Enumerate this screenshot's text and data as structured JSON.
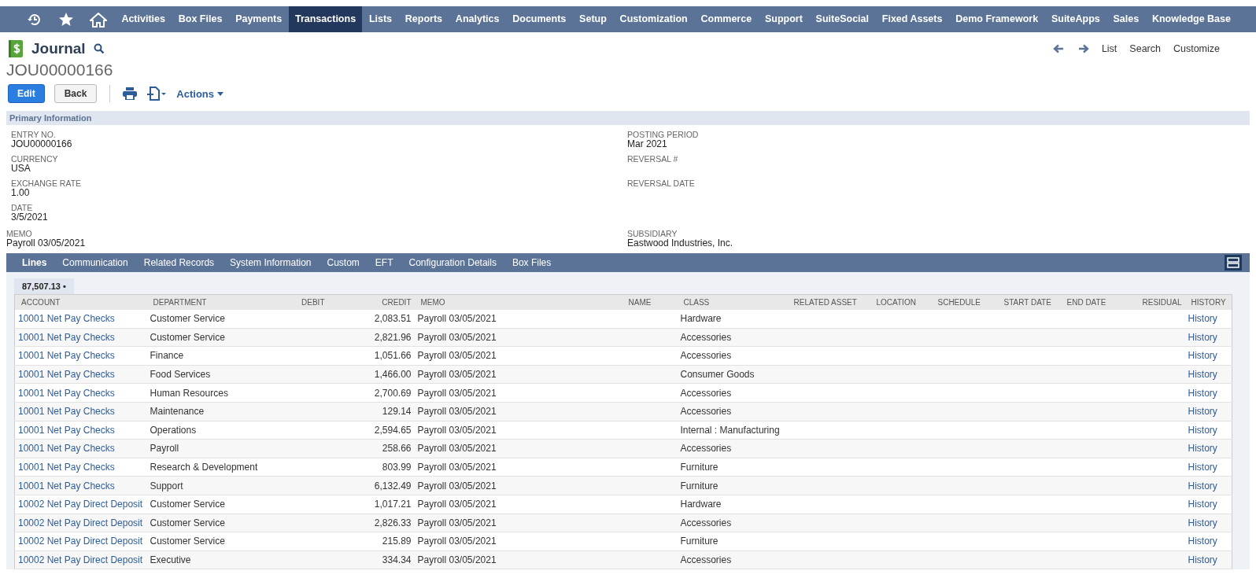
{
  "nav": {
    "items": [
      {
        "label": "Activities",
        "selected": false
      },
      {
        "label": "Box Files",
        "selected": false
      },
      {
        "label": "Payments",
        "selected": false
      },
      {
        "label": "Transactions",
        "selected": true
      },
      {
        "label": "Lists",
        "selected": false
      },
      {
        "label": "Reports",
        "selected": false
      },
      {
        "label": "Analytics",
        "selected": false
      },
      {
        "label": "Documents",
        "selected": false
      },
      {
        "label": "Setup",
        "selected": false
      },
      {
        "label": "Customization",
        "selected": false
      },
      {
        "label": "Commerce",
        "selected": false
      },
      {
        "label": "Support",
        "selected": false
      },
      {
        "label": "SuiteSocial",
        "selected": false
      },
      {
        "label": "Fixed Assets",
        "selected": false
      },
      {
        "label": "Demo Framework",
        "selected": false
      },
      {
        "label": "SuiteApps",
        "selected": false
      },
      {
        "label": "Sales",
        "selected": false
      },
      {
        "label": "Knowledge Base",
        "selected": false
      }
    ]
  },
  "record": {
    "type": "Journal",
    "number": "JOU00000166",
    "links": [
      "List",
      "Search",
      "Customize"
    ]
  },
  "toolbar": {
    "edit": "Edit",
    "back": "Back",
    "actions": "Actions"
  },
  "primary": {
    "title": "Primary Information",
    "left": [
      {
        "label": "ENTRY NO.",
        "value": "JOU00000166"
      },
      {
        "label": "CURRENCY",
        "value": "USA"
      },
      {
        "label": "EXCHANGE RATE",
        "value": "1.00"
      },
      {
        "label": "DATE",
        "value": "3/5/2021"
      }
    ],
    "right": [
      {
        "label": "POSTING PERIOD",
        "value": "Mar 2021"
      },
      {
        "label": "REVERSAL #"
      },
      {
        "label": "REVERSAL DATE"
      }
    ],
    "memo": {
      "label": "MEMO",
      "value": "Payroll 03/05/2021"
    },
    "subsidiary": {
      "label": "SUBSIDIARY",
      "value": "Eastwood Industries, Inc."
    }
  },
  "tabs": [
    {
      "label": "Lines",
      "selected": true
    },
    {
      "label": "Communication",
      "selected": false
    },
    {
      "label": "Related Records",
      "selected": false
    },
    {
      "label": "System Information",
      "selected": false
    },
    {
      "label": "Custom",
      "selected": false
    },
    {
      "label": "EFT",
      "selected": false
    },
    {
      "label": "Configuration Details",
      "selected": false
    },
    {
      "label": "Box Files",
      "selected": false
    }
  ],
  "total": "87,507.13 •",
  "table": {
    "columns": [
      "ACCOUNT",
      "DEPARTMENT",
      "DEBIT",
      "CREDIT",
      "MEMO",
      "NAME",
      "CLASS",
      "RELATED ASSET",
      "LOCATION",
      "SCHEDULE",
      "START DATE",
      "END DATE",
      "RESIDUAL",
      "HISTORY"
    ],
    "rows": [
      {
        "account": "10001 Net Pay Checks",
        "department": "Customer Service",
        "credit": "2,083.51",
        "memo": "Payroll 03/05/2021",
        "class": "Hardware",
        "history": "History"
      },
      {
        "account": "10001 Net Pay Checks",
        "department": "Customer Service",
        "credit": "2,821.96",
        "memo": "Payroll 03/05/2021",
        "class": "Accessories",
        "history": "History"
      },
      {
        "account": "10001 Net Pay Checks",
        "department": "Finance",
        "credit": "1,051.66",
        "memo": "Payroll 03/05/2021",
        "class": "Accessories",
        "history": "History"
      },
      {
        "account": "10001 Net Pay Checks",
        "department": "Food Services",
        "credit": "1,466.00",
        "memo": "Payroll 03/05/2021",
        "class": "Consumer Goods",
        "history": "History"
      },
      {
        "account": "10001 Net Pay Checks",
        "department": "Human Resources",
        "credit": "2,700.69",
        "memo": "Payroll 03/05/2021",
        "class": "Accessories",
        "history": "History"
      },
      {
        "account": "10001 Net Pay Checks",
        "department": "Maintenance",
        "credit": "129.14",
        "memo": "Payroll 03/05/2021",
        "class": "Accessories",
        "history": "History"
      },
      {
        "account": "10001 Net Pay Checks",
        "department": "Operations",
        "credit": "2,594.65",
        "memo": "Payroll 03/05/2021",
        "class": "Internal : Manufacturing",
        "history": "History"
      },
      {
        "account": "10001 Net Pay Checks",
        "department": "Payroll",
        "credit": "258.66",
        "memo": "Payroll 03/05/2021",
        "class": "Accessories",
        "history": "History"
      },
      {
        "account": "10001 Net Pay Checks",
        "department": "Research & Development",
        "credit": "803.99",
        "memo": "Payroll 03/05/2021",
        "class": "Furniture",
        "history": "History"
      },
      {
        "account": "10001 Net Pay Checks",
        "department": "Support",
        "credit": "6,132.49",
        "memo": "Payroll 03/05/2021",
        "class": "Furniture",
        "history": "History"
      },
      {
        "account": "10002 Net Pay Direct Deposit",
        "department": "Customer Service",
        "credit": "1,017.21",
        "memo": "Payroll 03/05/2021",
        "class": "Hardware",
        "history": "History"
      },
      {
        "account": "10002 Net Pay Direct Deposit",
        "department": "Customer Service",
        "credit": "2,826.33",
        "memo": "Payroll 03/05/2021",
        "class": "Accessories",
        "history": "History"
      },
      {
        "account": "10002 Net Pay Direct Deposit",
        "department": "Customer Service",
        "credit": "215.89",
        "memo": "Payroll 03/05/2021",
        "class": "Furniture",
        "history": "History"
      },
      {
        "account": "10002 Net Pay Direct Deposit",
        "department": "Executive",
        "credit": "334.34",
        "memo": "Payroll 03/05/2021",
        "class": "Accessories",
        "history": "History"
      }
    ]
  }
}
